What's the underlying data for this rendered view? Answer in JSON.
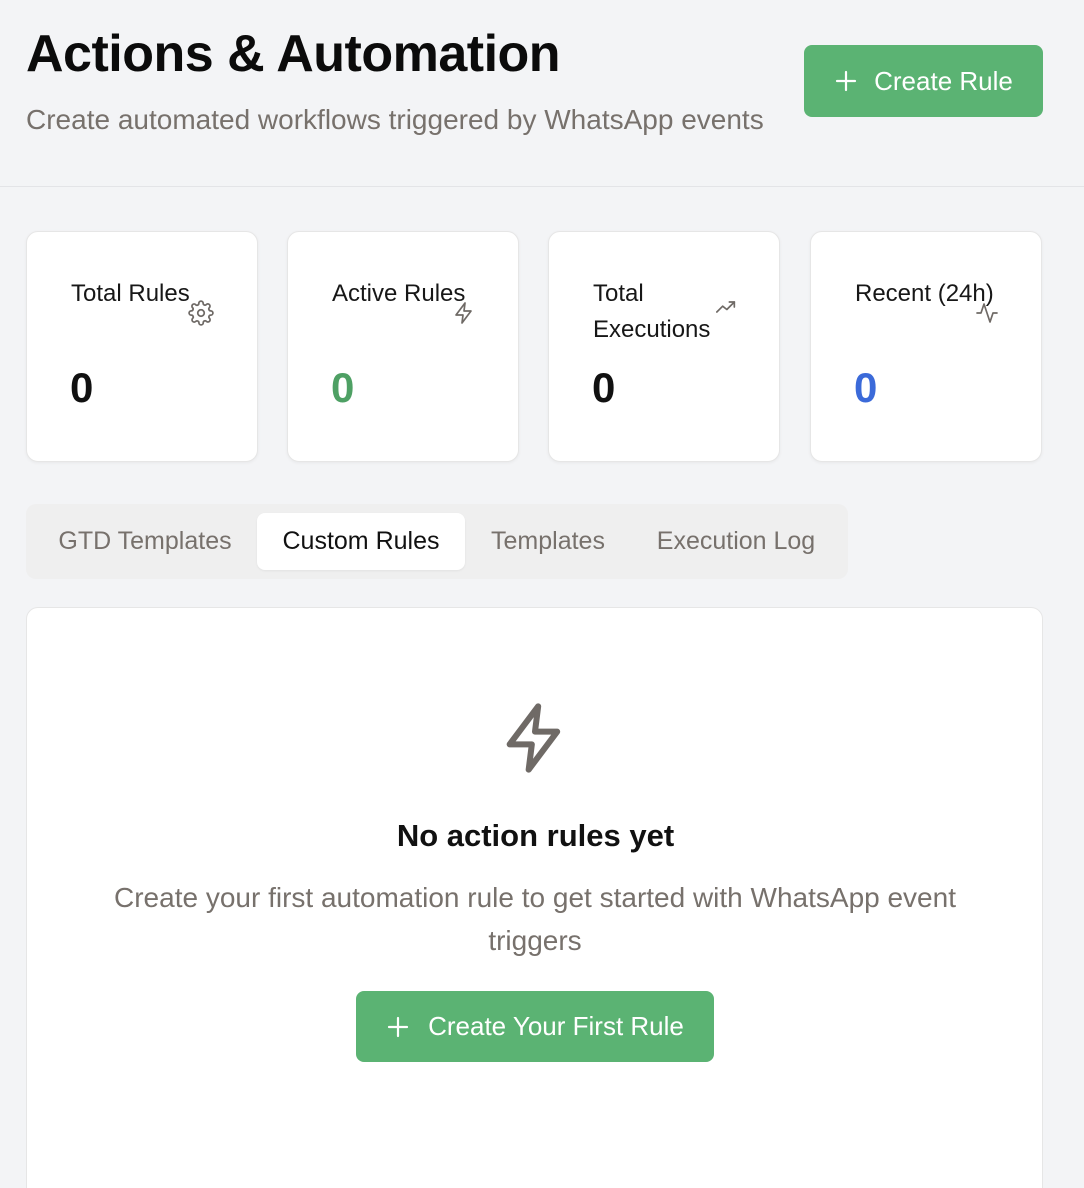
{
  "header": {
    "title": "Actions & Automation",
    "subtitle": "Create automated workflows triggered by WhatsApp events",
    "create_button_label": "Create Rule"
  },
  "stats": [
    {
      "label": "Total Rules",
      "value": "0",
      "icon": "gear-icon",
      "value_color": "#111111"
    },
    {
      "label": "Active Rules",
      "value": "0",
      "icon": "lightning-icon",
      "value_color": "#4ea064"
    },
    {
      "label": "Total Executions",
      "value": "0",
      "icon": "trending-up-icon",
      "value_color": "#111111"
    },
    {
      "label": "Recent (24h)",
      "value": "0",
      "icon": "activity-icon",
      "value_color": "#3b6ad9"
    }
  ],
  "tabs": [
    {
      "label": "GTD Templates",
      "active": false
    },
    {
      "label": "Custom Rules",
      "active": true
    },
    {
      "label": "Templates",
      "active": false
    },
    {
      "label": "Execution Log",
      "active": false
    }
  ],
  "empty_state": {
    "icon": "lightning-icon",
    "title": "No action rules yet",
    "description": "Create your first automation rule to get started with WhatsApp event triggers",
    "button_label": "Create Your First Rule"
  },
  "colors": {
    "accent_green": "#5bb373",
    "active_value_green": "#4ea064",
    "recent_value_blue": "#3b6ad9",
    "muted_text": "#77716c",
    "background": "#f3f4f6"
  }
}
